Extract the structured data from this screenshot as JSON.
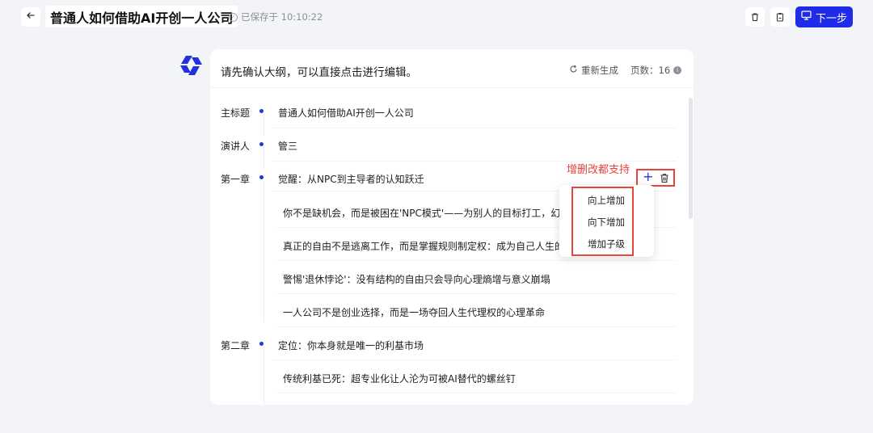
{
  "header": {
    "doc_title": "普通人如何借助AI开创一人公司",
    "save_status": "已保存于 10:10:22",
    "next_label": "下一步"
  },
  "panel": {
    "hint": "请先确认大纲，可以直接点击进行编辑。",
    "regen_label": "重新生成",
    "pages_label": "页数：16"
  },
  "outline": {
    "title_label": "主标题",
    "title_value": "普通人如何借助AI开创一人公司",
    "speaker_label": "演讲人",
    "speaker_value": "管三",
    "ch1_label": "第一章",
    "ch1_title": "觉醒：从NPC到主导者的认知跃迁",
    "ch1_sub": [
      "你不是缺机会，而是被困在'NPC模式'——为别人的目标打工，幻想退休",
      "真正的自由不是逃离工作，而是掌握规则制定权：成为自己人生的'导演'",
      "警惕'退休悖论'：没有结构的自由只会导向心理熵增与意义崩塌",
      "一人公司不是创业选择，而是一场夺回人生代理权的心理革命"
    ],
    "ch2_label": "第二章",
    "ch2_title": "定位：你本身就是唯一的利基市场",
    "ch2_sub": [
      "传统利基已死：超专业化让人沦为可被AI替代的螺丝钉"
    ]
  },
  "annotation": {
    "text": "增删改都支持"
  },
  "menu": {
    "items": [
      "向上增加",
      "向下增加",
      "增加子级"
    ]
  },
  "colors": {
    "accent": "#1f2be8",
    "annotation": "#e8443a",
    "background": "#f3f4f7"
  }
}
